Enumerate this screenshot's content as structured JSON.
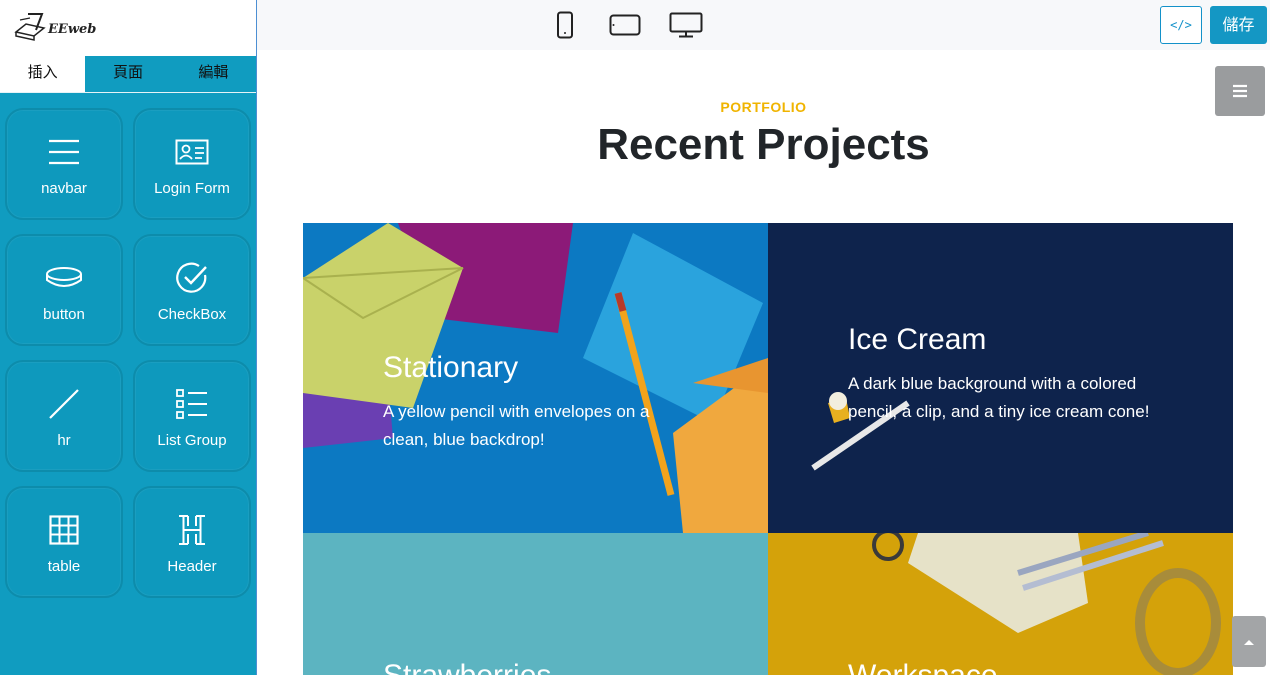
{
  "logo": {
    "text": "EEweb"
  },
  "tabs": [
    {
      "label": "插入",
      "active": true
    },
    {
      "label": "頁面",
      "active": false
    },
    {
      "label": "編輯",
      "active": false
    }
  ],
  "components": [
    {
      "label": "navbar",
      "icon": "hamburger-icon"
    },
    {
      "label": "Login Form",
      "icon": "id-card-icon"
    },
    {
      "label": "button",
      "icon": "button-pill-icon"
    },
    {
      "label": "CheckBox",
      "icon": "check-circle-icon"
    },
    {
      "label": "hr",
      "icon": "diagonal-line-icon"
    },
    {
      "label": "List Group",
      "icon": "list-icon"
    },
    {
      "label": "table",
      "icon": "grid-table-icon"
    },
    {
      "label": "Header",
      "icon": "h-heading-icon"
    }
  ],
  "toolbar": {
    "devices": [
      "mobile-icon",
      "tablet-icon",
      "desktop-icon"
    ],
    "code_label": "</>",
    "save_label": "儲存"
  },
  "section": {
    "eyebrow": "PORTFOLIO",
    "title": "Recent Projects"
  },
  "cards": [
    {
      "title": "Stationary",
      "desc": "A yellow pencil with envelopes on a clean, blue backdrop!",
      "bg": "#0c79c2"
    },
    {
      "title": "Ice Cream",
      "desc": "A dark blue background with a colored pencil, a clip, and a tiny ice cream cone!",
      "bg": "#0c1f45"
    },
    {
      "title": "Strawberries",
      "desc": "",
      "bg": "#62b9c4"
    },
    {
      "title": "Workspace",
      "desc": "",
      "bg": "#d4a20a"
    }
  ],
  "colors": {
    "sidebar": "#109cc0",
    "accent": "#1497c4",
    "eyebrow": "#f0b400"
  }
}
